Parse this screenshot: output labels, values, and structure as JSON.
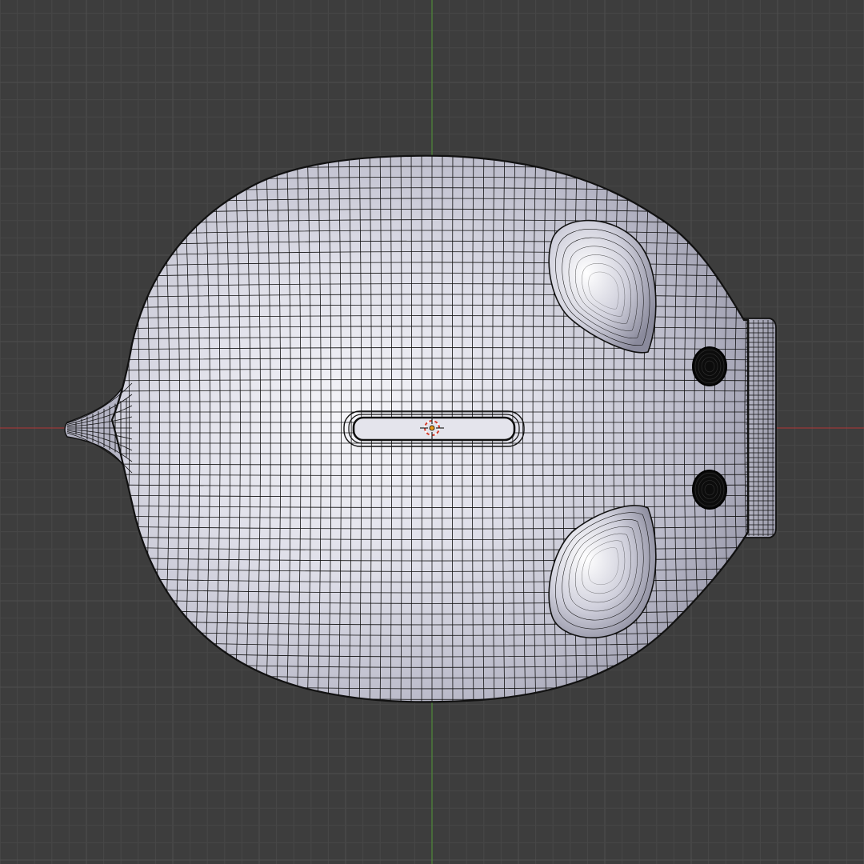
{
  "viewport": {
    "mode": "top-orthographic",
    "shading": "solid-with-wireframe-overlay",
    "grid": true
  },
  "colors": {
    "background": "#3d3d3d",
    "grid_minor": "#474747",
    "grid_major": "#4e4e4e",
    "x_axis": "#9a3a3a",
    "y_axis": "#4f8a3a",
    "mesh_light": "#f4f4f8",
    "mesh_mid": "#c9c9d6",
    "mesh_dark": "#8a8a9c",
    "wire": "#111111",
    "cursor_red": "#d23a2a",
    "cursor_white": "#ffffff",
    "origin": "#e89a1a"
  },
  "icons": {
    "cursor": "3d-cursor-icon",
    "origin": "object-origin-icon"
  }
}
